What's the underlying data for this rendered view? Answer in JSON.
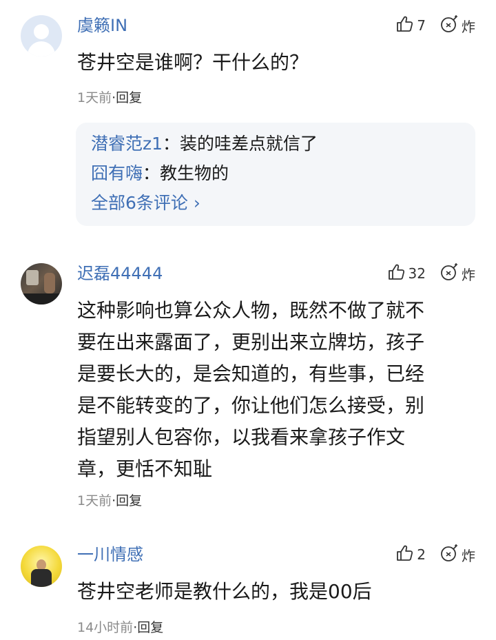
{
  "comments": [
    {
      "username": "虞籁IN",
      "likes": "7",
      "bomb_label": "炸",
      "text": "苍井空是谁啊？干什么的？",
      "time": "1天前",
      "reply_label": "·回复",
      "replies": [
        {
          "user": "潜睿范z1",
          "text": "：装的哇差点就信了"
        },
        {
          "user": "囧有嗨",
          "text": "：教生物的"
        }
      ],
      "all_replies_label": "全部6条评论 ›"
    },
    {
      "username": "迟磊44444",
      "likes": "32",
      "bomb_label": "炸",
      "text_lines": [
        "这种影响也算公众人物，既然不做了就不",
        "要在出来露面了，更别出来立牌坊，孩子",
        "是要长大的，是会知道的，有些事，已经",
        "是不能转变的了，你让他们怎么接受，别",
        "指望别人包容你，以我看来拿孩子作文",
        "章，更恬不知耻"
      ],
      "time": "1天前",
      "reply_label": "·回复"
    },
    {
      "username": "一川情感",
      "likes": "2",
      "bomb_label": "炸",
      "text": "苍井空老师是教什么的，我是00后",
      "time": "14小时前",
      "reply_label": "·回复"
    }
  ],
  "icons": {
    "like": "thumb-up-icon",
    "bomb": "bomb-icon"
  },
  "colors": {
    "username": "#3f6fb5",
    "meta": "#8a8a8a",
    "reply_box": "#f4f6f9"
  }
}
